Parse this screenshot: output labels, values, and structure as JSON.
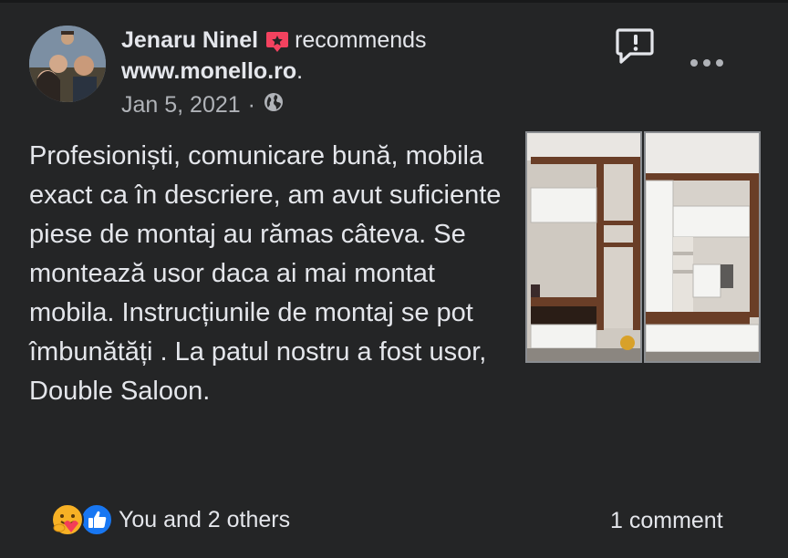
{
  "post": {
    "author": "Jenaru Ninel",
    "action": "recommends",
    "site": "www.monello.ro",
    "site_suffix": ".",
    "date": "Jan 5, 2021",
    "separator": "·",
    "text": "Profesioniști, comunicare bună, mobila exact ca în descriere, am avut suficiente piese de montaj au rămas câteva. Se montează usor daca ai mai montat mobila. Instrucțiunile de montaj se pot îmbunătăți . La patul nostru a fost usor, Double Saloon."
  },
  "footer": {
    "reactions_text": "You and 2 others",
    "comments_text": "1 comment"
  },
  "icons": {
    "recommend": "recommend-icon",
    "privacy": "globe-icon",
    "report": "report-icon",
    "more": "more-icon",
    "reaction_care": "care-reaction-icon",
    "reaction_like": "like-reaction-icon"
  },
  "colors": {
    "background": "#242526",
    "text": "#e4e6eb",
    "secondary_text": "#b0b3b8",
    "recommend_red": "#f3425f",
    "like_blue": "#1877f2"
  }
}
